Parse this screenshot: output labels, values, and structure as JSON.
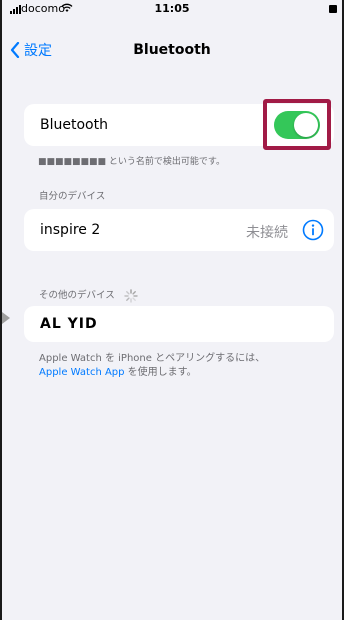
{
  "status_bar": {
    "carrier": "docomo",
    "time": "11:05",
    "icons": [
      "signal-icon",
      "wifi-icon",
      "battery-icon"
    ]
  },
  "nav": {
    "back_label": "設定",
    "title": "Bluetooth"
  },
  "bluetooth_toggle": {
    "label": "Bluetooth",
    "on": true,
    "color": "#34c759"
  },
  "discoverable_note": "■■■■■■■■ という名前で検出可能です。",
  "my_devices": {
    "header": "自分のデバイス",
    "items": [
      {
        "name": "inspire 2",
        "status": "未接続"
      }
    ]
  },
  "other_devices": {
    "header": "その他のデバイス",
    "items": [
      {
        "name": "AL YID"
      }
    ]
  },
  "pairing_note": {
    "text_prefix": "Apple Watch を iPhone とペアリングするには、",
    "link_text": "Apple Watch App",
    "text_suffix": " を使用します。"
  },
  "colors": {
    "accent": "#007aff",
    "highlight_border": "#a11b46",
    "background": "#f2f2f7"
  }
}
